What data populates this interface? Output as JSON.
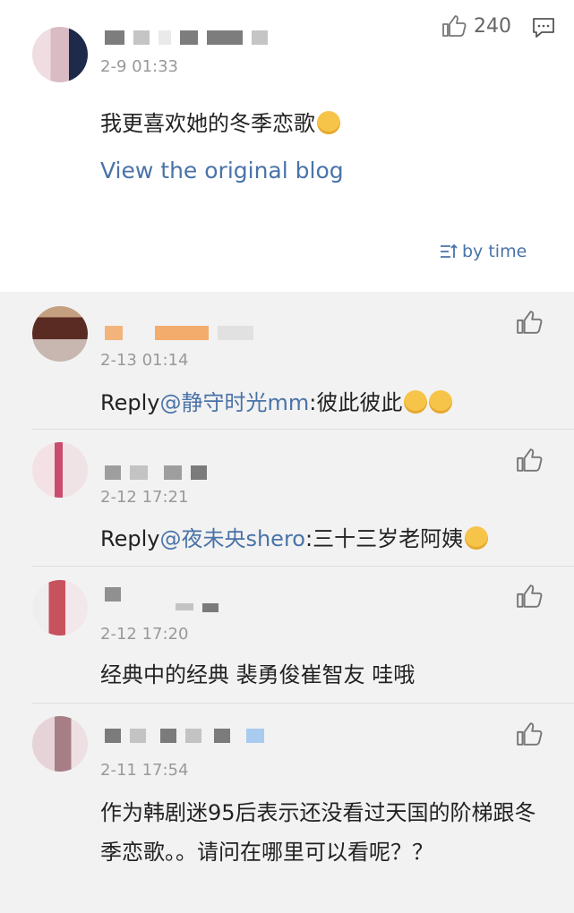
{
  "main": {
    "timestamp": "2-9 01:33",
    "like_count": "240",
    "text": "我更喜欢她的冬季恋歌",
    "view_original": "View the original blog",
    "sort_label": "by time"
  },
  "replies": [
    {
      "timestamp": "2-13 01:14",
      "prefix": "Reply",
      "mention": "@静守时光mm",
      "text": ":彼此彼此"
    },
    {
      "timestamp": "2-12 17:21",
      "prefix": "Reply",
      "mention": "@夜未央shero",
      "text": ":三十三岁老阿姨"
    },
    {
      "timestamp": "2-12 17:20",
      "text": "经典中的经典 裴勇俊崔智友 哇哦"
    },
    {
      "timestamp": "2-11 17:54",
      "text": "作为韩剧迷95后表示还没看过天国的阶梯跟冬季恋歌。。请问在哪里可以看呢？？"
    }
  ],
  "icons": {
    "like": "thumbs-up-icon",
    "reply": "comment-icon",
    "sort": "sort-icon",
    "emoji": "emoji-icon"
  },
  "colors": {
    "link": "#4a73a8",
    "background": "#f2f2f2"
  }
}
